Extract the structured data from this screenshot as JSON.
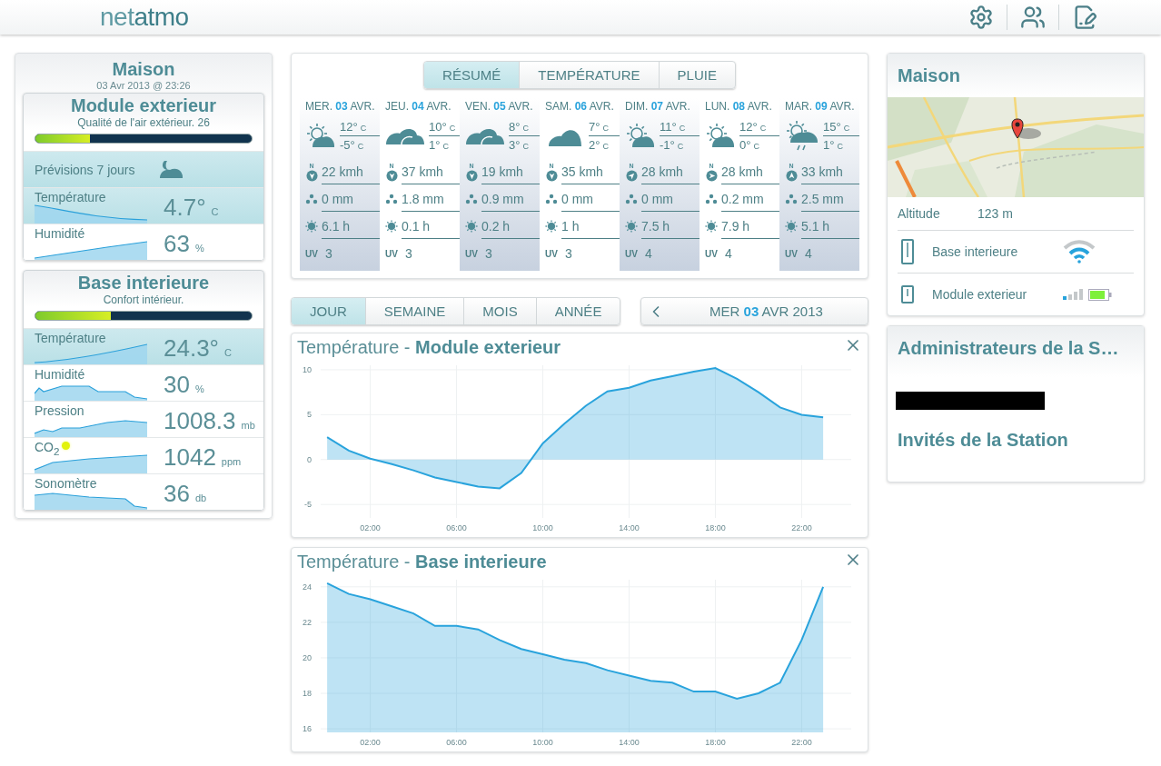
{
  "header": {
    "logo": "net**atmo**"
  },
  "station": {
    "title": "Maison",
    "date": "03 Avr 2013 @ 23:26",
    "modules": [
      {
        "title": "Module exterieur",
        "subtitle": "Qualité de l'air extérieur. 26",
        "level": 0.25,
        "rows": [
          {
            "kind": "forecast",
            "label": "Prévisions 7 jours",
            "selected": true
          },
          {
            "kind": "measure",
            "label": "Température",
            "value": "4.7°",
            "unit": "C",
            "selected": true
          },
          {
            "kind": "measure",
            "label": "Humidité",
            "value": "63",
            "unit": "%",
            "selected": false
          }
        ]
      },
      {
        "title": "Base interieure",
        "subtitle": "Confort intérieur.",
        "level": 0.35,
        "rows": [
          {
            "kind": "measure",
            "label": "Température",
            "value": "24.3°",
            "unit": "C",
            "selected": true
          },
          {
            "kind": "measure",
            "label": "Humidité",
            "value": "30",
            "unit": "%",
            "selected": false
          },
          {
            "kind": "measure",
            "label": "Pression",
            "value": "1008.3",
            "unit": "mb",
            "selected": false
          },
          {
            "kind": "measure",
            "label": "CO$_{2}$",
            "value": "1042",
            "unit": "ppm",
            "selected": false,
            "color": "#e2f20c"
          },
          {
            "kind": "measure",
            "label": "Sonomètre",
            "value": "36",
            "unit": "db",
            "selected": false
          }
        ]
      }
    ]
  },
  "forecast": {
    "tabs": [
      {
        "label": "RÉSUMÉ",
        "selected": true
      },
      {
        "label": "TEMPÉRATURE",
        "selected": false
      },
      {
        "label": "PLUIE",
        "selected": false
      }
    ],
    "days": [
      {
        "kind": "sun-cloud",
        "day": "MER. **03** AVR.",
        "max": "12°",
        "max_unit": "C",
        "min": "-5°",
        "min_unit": "C",
        "wind": {
          "kind": "south",
          "label": "N",
          "speed": "22 kmh"
        },
        "rain": "0 mm",
        "sun": "6.1 h",
        "uv_label": "UV",
        "uv": "3"
      },
      {
        "kind": "clouds",
        "day": "JEU. **04** AVR.",
        "max": "10°",
        "max_unit": "C",
        "min": "1°",
        "min_unit": "C",
        "wind": {
          "kind": "south",
          "label": "N",
          "speed": "37 kmh"
        },
        "rain": "1.8 mm",
        "sun": "0.1 h",
        "uv_label": "UV",
        "uv": "3"
      },
      {
        "kind": "clouds",
        "day": "VEN. **05** AVR.",
        "max": "8°",
        "max_unit": "C",
        "min": "3°",
        "min_unit": "C",
        "wind": {
          "kind": "south",
          "label": "N",
          "speed": "19 kmh"
        },
        "rain": "0.9 mm",
        "sun": "0.2 h",
        "uv_label": "UV",
        "uv": "3"
      },
      {
        "kind": "cloud",
        "day": "SAM. **06** AVR.",
        "max": "7°",
        "max_unit": "C",
        "min": "2°",
        "min_unit": "C",
        "wind": {
          "kind": "south",
          "label": "N",
          "speed": "35 kmh"
        },
        "rain": "0 mm",
        "sun": "1 h",
        "uv_label": "UV",
        "uv": "3"
      },
      {
        "kind": "sun-cloud",
        "day": "DIM. **07** AVR.",
        "max": "11°",
        "max_unit": "C",
        "min": "-1°",
        "min_unit": "C",
        "wind": {
          "kind": "northeast",
          "label": "N",
          "speed": "28 kmh"
        },
        "rain": "0 mm",
        "sun": "7.5 h",
        "uv_label": "UV",
        "uv": "4"
      },
      {
        "kind": "sun-cloud",
        "day": "LUN. **08** AVR.",
        "max": "12°",
        "max_unit": "C",
        "min": "0°",
        "min_unit": "C",
        "wind": {
          "kind": "east",
          "label": "N",
          "speed": "28 kmh"
        },
        "rain": "0.2 mm",
        "sun": "7.9 h",
        "uv_label": "UV",
        "uv": "4"
      },
      {
        "kind": "rain",
        "day": "MAR. **09** AVR.",
        "max": "15°",
        "max_unit": "C",
        "min": "1°",
        "min_unit": "C",
        "wind": {
          "kind": "north",
          "label": "N",
          "speed": "33 kmh"
        },
        "rain": "2.5 mm",
        "sun": "5.1 h",
        "uv_label": "UV",
        "uv": "4"
      }
    ]
  },
  "period": {
    "tabs": [
      {
        "label": "JOUR",
        "selected": true
      },
      {
        "label": "SEMAINE",
        "selected": false
      },
      {
        "label": "MOIS",
        "selected": false
      },
      {
        "label": "ANNÉE",
        "selected": false
      }
    ],
    "date": "MER **03** AVR 2013"
  },
  "charts": [
    {
      "title": "Température - **Module exterieur**",
      "chart_data": {
        "type": "area",
        "grid": true,
        "x": [
          0,
          1,
          2,
          3,
          4,
          5,
          6,
          7,
          8,
          9,
          10,
          11,
          12,
          13,
          14,
          15,
          16,
          17,
          18,
          19,
          20,
          21,
          22,
          23
        ],
        "series": [
          {
            "color": "#29a3dc",
            "values": [
              2.5,
              1.0,
              0.1,
              -0.5,
              -1.2,
              -2.0,
              -2.5,
              -3.0,
              -3.2,
              -1.5,
              1.8,
              4.0,
              6.0,
              7.6,
              8.0,
              8.8,
              9.3,
              9.8,
              10.2,
              9.0,
              7.5,
              5.8,
              5.0,
              4.7
            ]
          }
        ],
        "xlim": [
          -0.3,
          24.3
        ],
        "ylim": [
          -6.5,
          10.5
        ],
        "xticks": [
          {
            "value": 2,
            "label": "02:00"
          },
          {
            "value": 6,
            "label": "06:00"
          },
          {
            "value": 10,
            "label": "10:00"
          },
          {
            "value": 14,
            "label": "14:00"
          },
          {
            "value": 18,
            "label": "18:00"
          },
          {
            "value": 22,
            "label": "22:00"
          }
        ],
        "yticks": [
          -5,
          0,
          5,
          10
        ]
      }
    },
    {
      "title": "Température - **Base interieure**",
      "chart_data": {
        "type": "area",
        "grid": true,
        "x": [
          0,
          1,
          2,
          3,
          4,
          5,
          6,
          7,
          8,
          9,
          10,
          11,
          12,
          13,
          14,
          15,
          16,
          17,
          18,
          19,
          20,
          21,
          22,
          23
        ],
        "series": [
          {
            "color": "#29a3dc",
            "values": [
              24.2,
              23.6,
              23.3,
              22.9,
              22.5,
              21.8,
              21.8,
              21.6,
              21.0,
              20.5,
              20.2,
              19.9,
              19.7,
              19.3,
              19.0,
              18.7,
              18.6,
              18.1,
              18.1,
              17.7,
              18.0,
              18.6,
              21.0,
              24.0
            ]
          }
        ],
        "xlim": [
          -0.3,
          24.3
        ],
        "ylim": [
          15.8,
          24.4
        ],
        "xticks": [
          {
            "value": 2,
            "label": "02:00"
          },
          {
            "value": 6,
            "label": "06:00"
          },
          {
            "value": 10,
            "label": "10:00"
          },
          {
            "value": 14,
            "label": "14:00"
          },
          {
            "value": 18,
            "label": "18:00"
          },
          {
            "value": 22,
            "label": "22:00"
          }
        ],
        "yticks": [
          16,
          18,
          20,
          22,
          24
        ]
      }
    }
  ],
  "location": {
    "title": "Maison",
    "altitude_label": "Altitude",
    "altitude": "123 m",
    "devices": [
      {
        "kind": "base",
        "name": "Base interieure"
      },
      {
        "kind": "module",
        "name": "Module exterieur"
      }
    ]
  },
  "people": {
    "admins_title": "Administrateurs de la S…",
    "guests_title": "Invités de la Station"
  }
}
